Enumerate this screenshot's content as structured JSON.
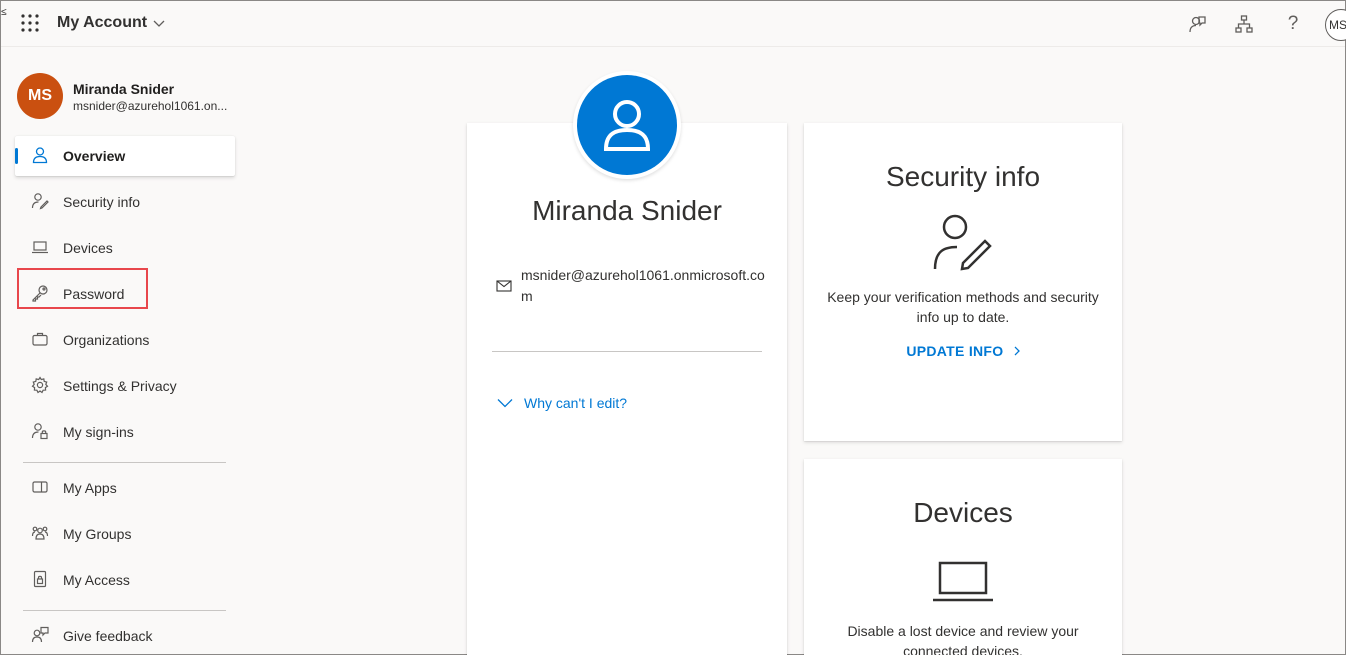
{
  "header": {
    "title": "My Account",
    "avatar_initials": "MS",
    "help_glyph": "?",
    "edge_mark": "≤"
  },
  "user": {
    "initials": "MS",
    "name": "Miranda Snider",
    "email_short": "msnider@azurehol1061.on...",
    "email_full": "msnider@azurehol1061.onmicrosoft.com"
  },
  "sidebar": {
    "items": [
      {
        "label": "Overview",
        "icon": "person-icon",
        "active": true
      },
      {
        "label": "Security info",
        "icon": "person-edit-icon"
      },
      {
        "label": "Devices",
        "icon": "laptop-icon"
      },
      {
        "label": "Password",
        "icon": "key-icon",
        "highlighted": true
      },
      {
        "label": "Organizations",
        "icon": "briefcase-icon"
      },
      {
        "label": "Settings & Privacy",
        "icon": "gear-icon"
      },
      {
        "label": "My sign-ins",
        "icon": "person-lock-icon"
      },
      {
        "label": "My Apps",
        "icon": "apps-icon"
      },
      {
        "label": "My Groups",
        "icon": "people-icon"
      },
      {
        "label": "My Access",
        "icon": "lock-doc-icon"
      },
      {
        "label": "Give feedback",
        "icon": "feedback-icon"
      }
    ]
  },
  "profile_card": {
    "name": "Miranda Snider",
    "email": "msnider@azurehol1061.onmicrosoft.com",
    "why_edit": "Why can't I edit?"
  },
  "security_card": {
    "title": "Security info",
    "description": "Keep your verification methods and security info up to date.",
    "link": "UPDATE INFO"
  },
  "devices_card": {
    "title": "Devices",
    "description": "Disable a lost device and review your connected devices."
  },
  "colors": {
    "accent": "#0078d4",
    "avatar": "#ca5010",
    "highlight": "#e8474c"
  }
}
